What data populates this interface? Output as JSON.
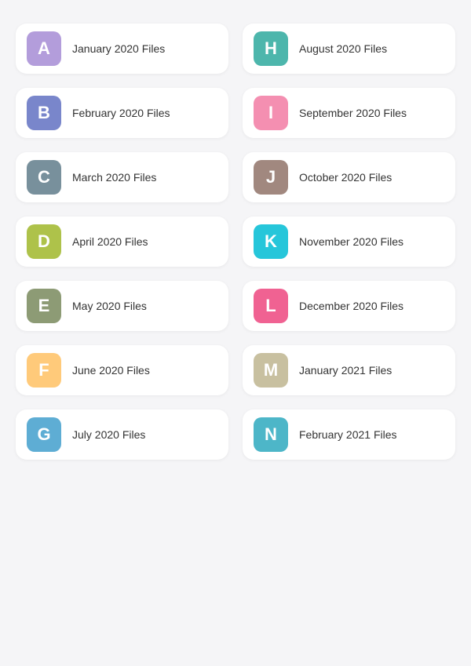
{
  "folders": [
    {
      "letter": "A",
      "label": "January 2020 Files",
      "color": "#b39ddb"
    },
    {
      "letter": "H",
      "label": "August 2020 Files",
      "color": "#4db6ac"
    },
    {
      "letter": "B",
      "label": "February 2020 Files",
      "color": "#7986cb"
    },
    {
      "letter": "I",
      "label": "September 2020 Files",
      "color": "#f48fb1"
    },
    {
      "letter": "C",
      "label": "March 2020 Files",
      "color": "#78909c"
    },
    {
      "letter": "J",
      "label": "October 2020 Files",
      "color": "#a1887f"
    },
    {
      "letter": "D",
      "label": "April 2020 Files",
      "color": "#aec24a"
    },
    {
      "letter": "K",
      "label": "November 2020 Files",
      "color": "#26c6da"
    },
    {
      "letter": "E",
      "label": "May 2020 Files",
      "color": "#8d9b75"
    },
    {
      "letter": "L",
      "label": "December 2020 Files",
      "color": "#f06292"
    },
    {
      "letter": "F",
      "label": "June 2020 Files",
      "color": "#ffca7a"
    },
    {
      "letter": "M",
      "label": "January 2021 Files",
      "color": "#c8c0a0"
    },
    {
      "letter": "G",
      "label": "July 2020 Files",
      "color": "#5eadd4"
    },
    {
      "letter": "N",
      "label": "February 2021 Files",
      "color": "#4db6c8"
    }
  ]
}
